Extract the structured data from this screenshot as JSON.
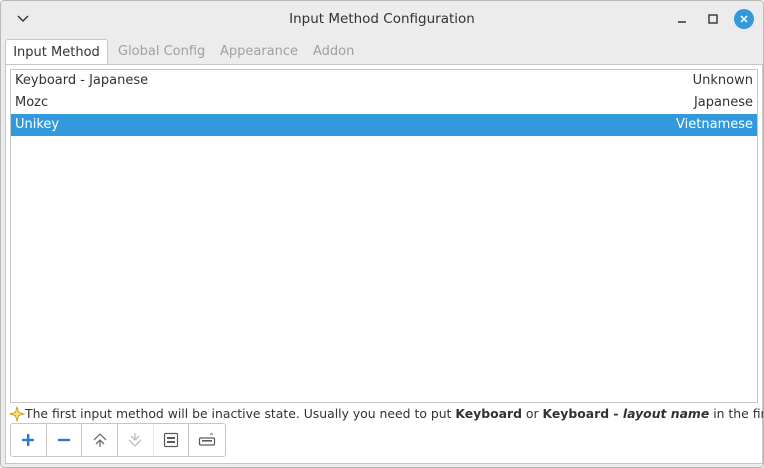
{
  "window": {
    "title": "Input Method Configuration"
  },
  "tabs": [
    {
      "label": "Input Method",
      "active": true
    },
    {
      "label": "Global Config",
      "active": false
    },
    {
      "label": "Appearance",
      "active": false
    },
    {
      "label": "Addon",
      "active": false
    }
  ],
  "input_methods": [
    {
      "name": "Keyboard - Japanese",
      "language": "Unknown",
      "selected": false
    },
    {
      "name": "Mozc",
      "language": "Japanese",
      "selected": false
    },
    {
      "name": "Unikey",
      "language": "Vietnamese",
      "selected": true
    }
  ],
  "hint": {
    "part1": "The first input method will be inactive state. Usually you need to put ",
    "bold1": "Keyboard",
    "part2": " or ",
    "bold2": "Keyboard - ",
    "italic": "layout name",
    "part3": " in the first place."
  },
  "toolbar": {
    "buttons": [
      {
        "icon": "plus-icon",
        "enabled": true
      },
      {
        "icon": "minus-icon",
        "enabled": true
      },
      {
        "icon": "move-up-icon",
        "enabled": true
      },
      {
        "icon": "move-down-icon",
        "enabled": false
      },
      {
        "icon": "configure-icon",
        "enabled": true
      },
      {
        "icon": "keyboard-layout-icon",
        "enabled": true
      }
    ]
  },
  "colors": {
    "selection": "#3399dd",
    "close_button": "#3498db",
    "accent_icon": "#2a7fc8"
  }
}
